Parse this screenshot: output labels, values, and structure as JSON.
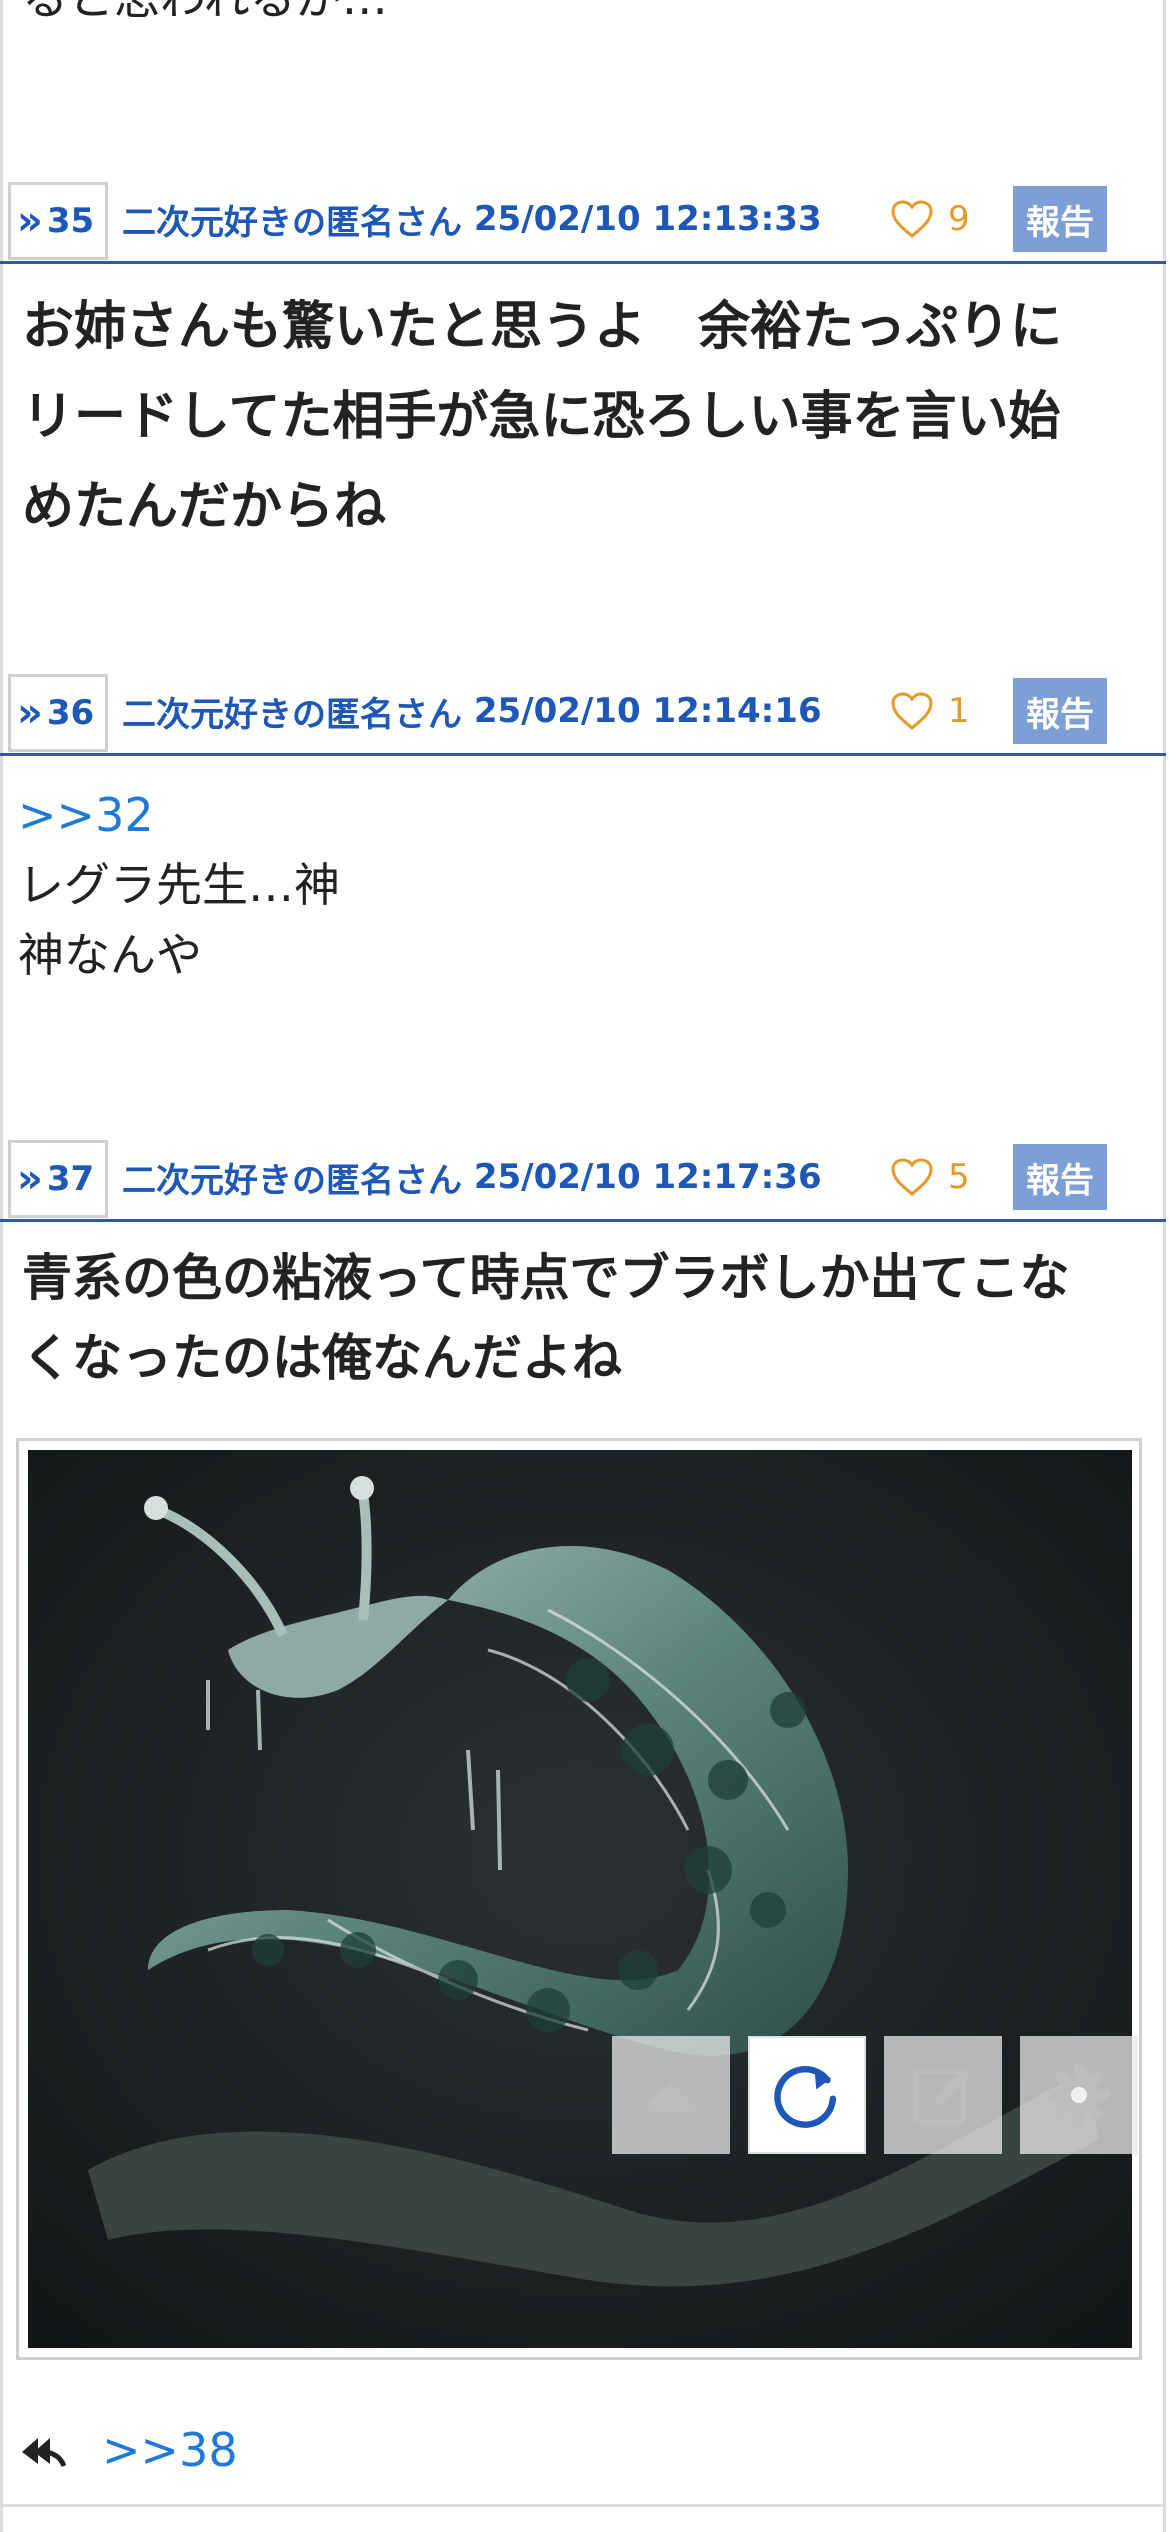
{
  "top_fragment": "ると思われるが…",
  "posts": [
    {
      "number": "35",
      "author": "二次元好きの匿名さん",
      "datetime": "25/02/10 12:13:33",
      "likes": "9",
      "report_label": "報告",
      "body_lines": [
        "お姉さんも驚いたと思うよ　余裕たっぷりに",
        "リードしてた相手が急に恐ろしい事を言い始",
        "めたんだからね"
      ]
    },
    {
      "number": "36",
      "author": "二次元好きの匿名さん",
      "datetime": "25/02/10 12:14:16",
      "likes": "1",
      "report_label": "報告",
      "anchor": ">>32",
      "body_lines": [
        "レグラ先生…神",
        "神なんや"
      ]
    },
    {
      "number": "37",
      "author": "二次元好きの匿名さん",
      "datetime": "25/02/10 12:17:36",
      "likes": "5",
      "report_label": "報告",
      "body_lines": [
        "青系の色の粘液って時点でブラボしか出てこな",
        "くなったのは俺なんだよね"
      ]
    }
  ],
  "image_controls": [
    "scroll-up-icon",
    "refresh-icon",
    "edit-icon",
    "settings-icon"
  ],
  "footer": {
    "reply_link": ">>38"
  },
  "colors": {
    "accent": "#1d57b8",
    "link": "#1d7ad8",
    "like": "#e59a2a",
    "report_bg": "#7e9fd6"
  }
}
